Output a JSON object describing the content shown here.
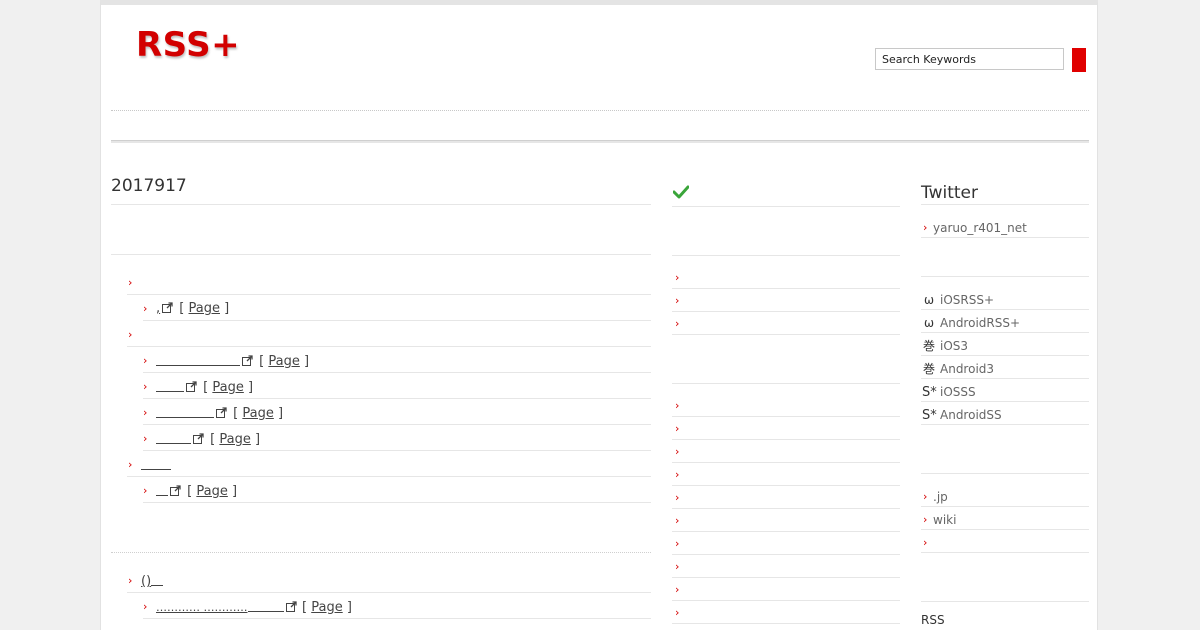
{
  "header": {
    "logo": "RSS+",
    "search_placeholder": "Search Keywords"
  },
  "main": {
    "date_title": "2017917",
    "feed_groups": [
      {
        "title": "",
        "items": [
          {
            "link": "",
            "page_label": "Page"
          }
        ]
      },
      {
        "title": "",
        "items": [
          {
            "link": "",
            "page_label": "Page"
          },
          {
            "link": "",
            "page_label": "Page"
          },
          {
            "link": "",
            "page_label": "Page"
          },
          {
            "link": "",
            "page_label": "Page"
          }
        ]
      },
      {
        "title": "",
        "items": [
          {
            "link": "",
            "page_label": "Page"
          }
        ]
      }
    ],
    "second_group_title": "()",
    "second_group_items": [
      {
        "link": "…………  …………",
        "page_label": "Page"
      }
    ]
  },
  "middle": {
    "check_icon": "check-icon",
    "list_a_count_items": [
      "",
      "",
      ""
    ],
    "list_b_items": [
      "",
      "",
      "",
      "",
      "",
      "",
      "",
      "",
      "",
      ""
    ]
  },
  "sidebar": {
    "twitter_title": "Twitter",
    "twitter_account": "yaruo_r401_net",
    "apps": [
      {
        "icon": "ω",
        "label": "iOSRSS+"
      },
      {
        "icon": "ω",
        "label": "AndroidRSS+"
      },
      {
        "icon": "巻",
        "label": "iOS3"
      },
      {
        "icon": "巻",
        "label": "Android3"
      },
      {
        "icon": "S*",
        "label": "iOSSS"
      },
      {
        "icon": "S*",
        "label": "AndroidSS"
      }
    ],
    "links": [
      ".jp",
      "wiki",
      ""
    ],
    "rss_label": "RSS"
  },
  "colors": {
    "accent": "#d20000",
    "chevron": "#d40000",
    "check": "#3aa53a"
  }
}
